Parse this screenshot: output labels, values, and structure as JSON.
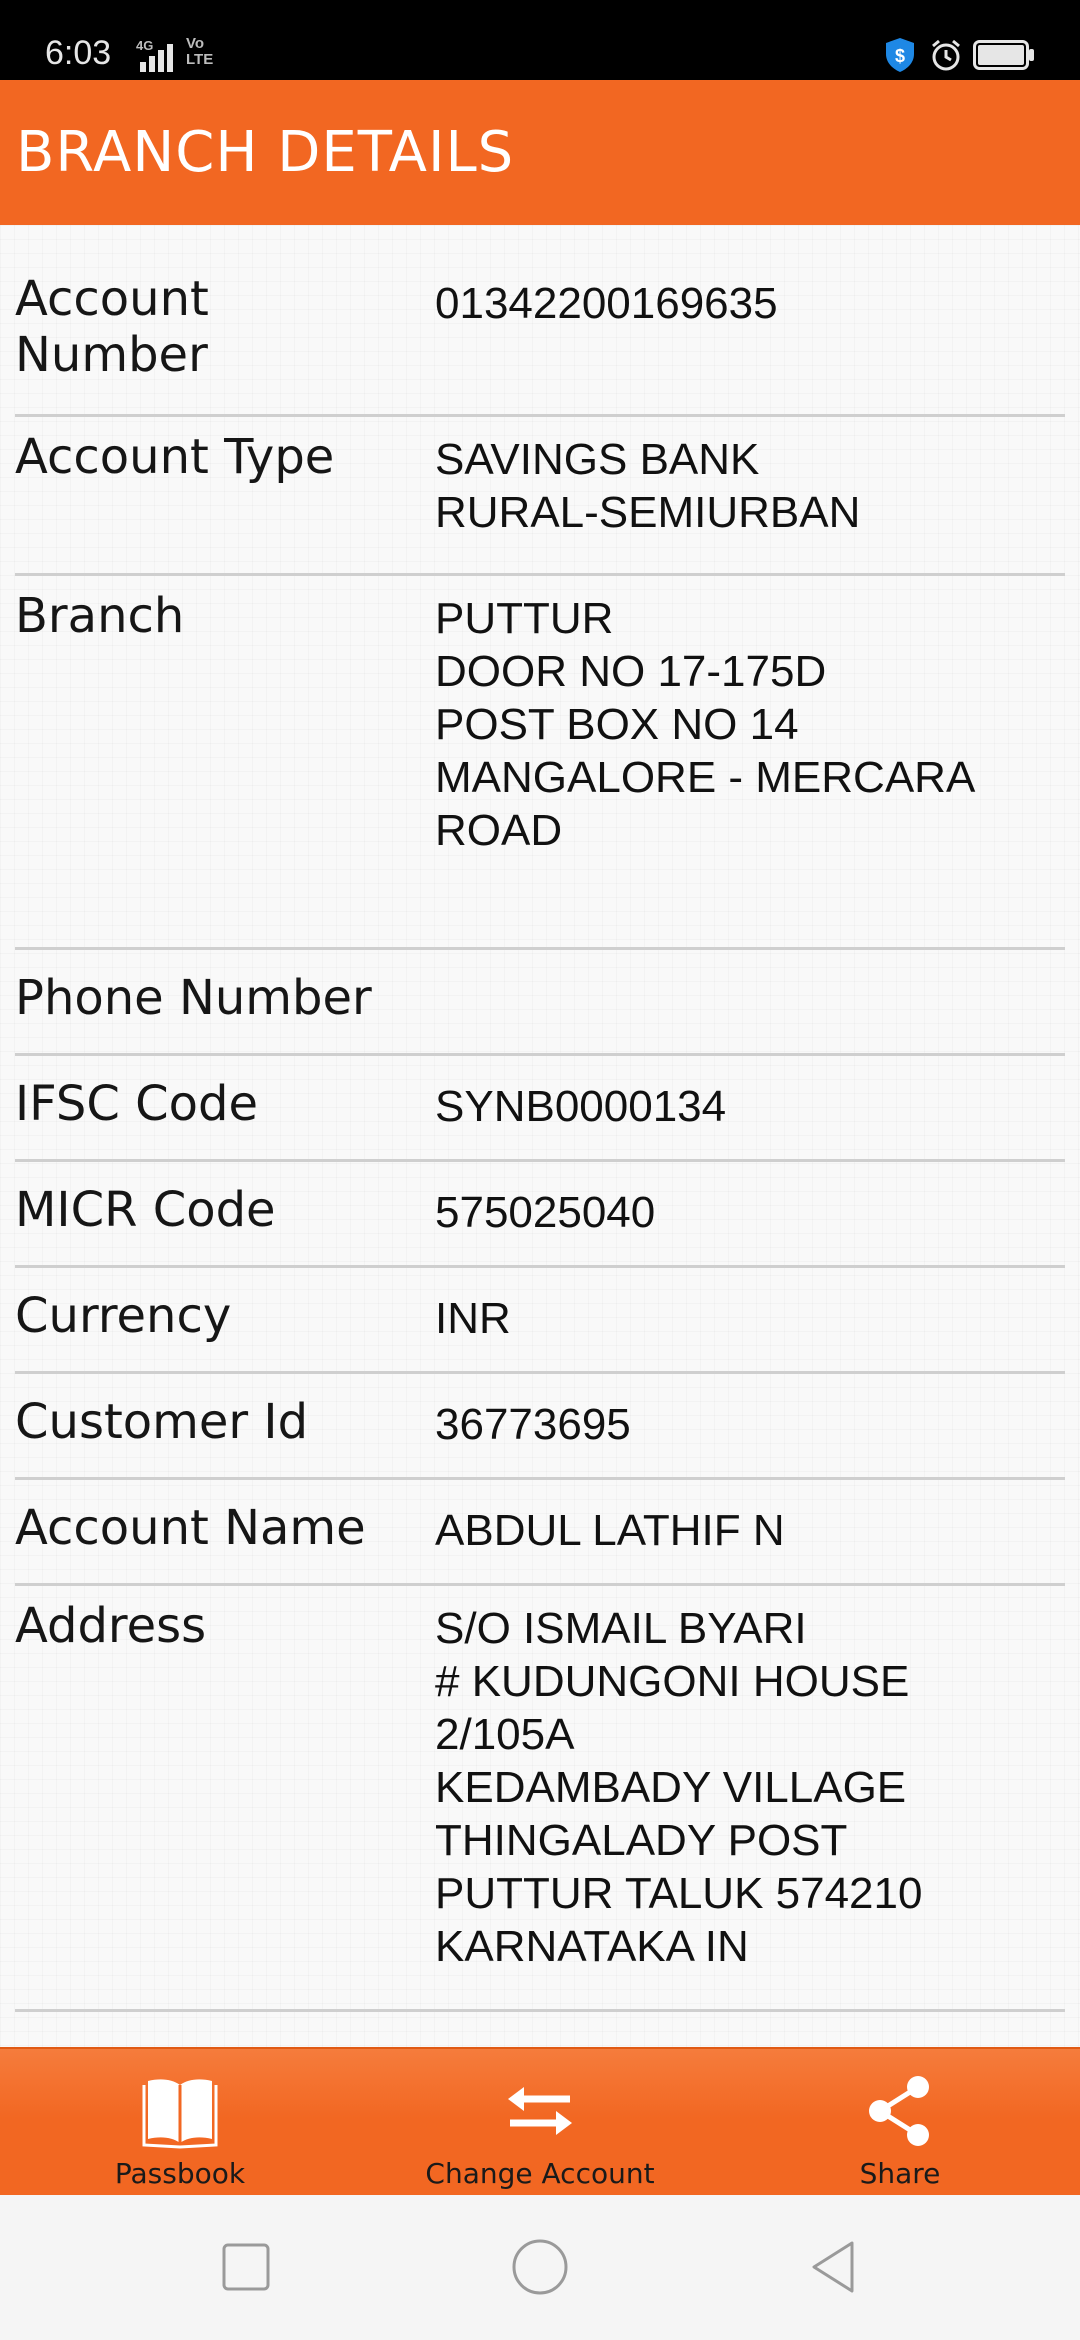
{
  "status_bar": {
    "time": "6:03",
    "network": "4G",
    "volte_line1": "Vo",
    "volte_line2": "LTE"
  },
  "header": {
    "title": "BRANCH DETAILS"
  },
  "details": [
    {
      "label": "Account\nNumber",
      "value": "01342200169635"
    },
    {
      "label": "Account Type",
      "value": "SAVINGS BANK\nRURAL-SEMIURBAN"
    },
    {
      "label": "Branch",
      "value": "PUTTUR\nDOOR NO 17-175D\nPOST BOX NO 14\nMANGALORE - MERCARA\nROAD"
    },
    {
      "label": "Phone Number",
      "value": ""
    },
    {
      "label": "IFSC Code",
      "value": "SYNB0000134"
    },
    {
      "label": "MICR Code",
      "value": "575025040"
    },
    {
      "label": "Currency",
      "value": "INR"
    },
    {
      "label": "Customer Id",
      "value": "36773695"
    },
    {
      "label": "Account Name",
      "value": "ABDUL LATHIF N"
    },
    {
      "label": "Address",
      "value": "S/O ISMAIL BYARI\n# KUDUNGONI HOUSE\n2/105A\nKEDAMBADY VILLAGE\nTHINGALADY POST\nPUTTUR TALUK 574210\nKARNATAKA IN"
    }
  ],
  "bottom_nav": [
    {
      "label": "Passbook",
      "icon": "book-icon"
    },
    {
      "label": "Change Account",
      "icon": "swap-arrows-icon"
    },
    {
      "label": "Share",
      "icon": "share-icon"
    }
  ],
  "system_nav": {
    "buttons": [
      "recents-button",
      "home-button",
      "back-button"
    ]
  },
  "colors": {
    "accent": "#f26722",
    "status_bar": "#000000",
    "divider": "#cfcfcf",
    "shield": "#1e88e5"
  }
}
